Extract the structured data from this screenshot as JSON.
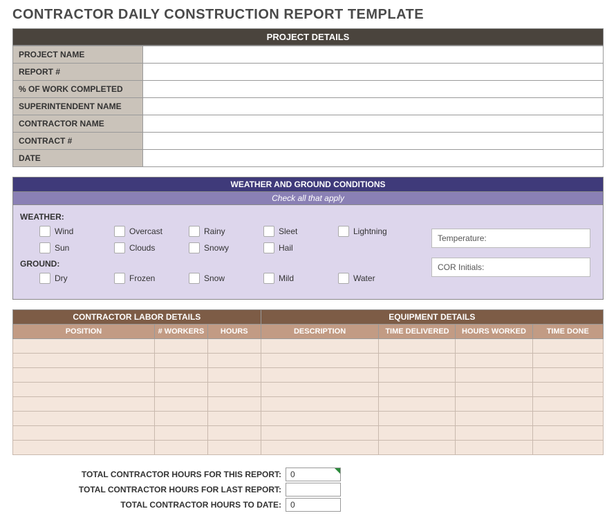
{
  "title": "CONTRACTOR DAILY CONSTRUCTION REPORT TEMPLATE",
  "project_details": {
    "header": "PROJECT DETAILS",
    "rows": [
      {
        "label": "PROJECT NAME",
        "value": ""
      },
      {
        "label": "REPORT #",
        "value": ""
      },
      {
        "label": "% OF WORK COMPLETED",
        "value": ""
      },
      {
        "label": "SUPERINTENDENT NAME",
        "value": ""
      },
      {
        "label": "CONTRACTOR NAME",
        "value": ""
      },
      {
        "label": "CONTRACT #",
        "value": ""
      },
      {
        "label": "DATE",
        "value": ""
      }
    ]
  },
  "weather": {
    "header": "WEATHER AND GROUND CONDITIONS",
    "subheader": "Check all that apply",
    "weather_label": "WEATHER:",
    "ground_label": "GROUND:",
    "weather_row1": [
      "Wind",
      "Overcast",
      "Rainy",
      "Sleet",
      "Lightning"
    ],
    "weather_row2": [
      "Sun",
      "Clouds",
      "Snowy",
      "Hail"
    ],
    "ground_row1": [
      "Dry",
      "Frozen",
      "Snow",
      "Mild",
      "Water"
    ],
    "temperature_label": "Temperature:",
    "cor_initials_label": "COR Initials:"
  },
  "labor": {
    "section1": "CONTRACTOR LABOR DETAILS",
    "section2": "EQUIPMENT DETAILS",
    "columns": [
      "POSITION",
      "# WORKERS",
      "HOURS",
      "DESCRIPTION",
      "TIME DELIVERED",
      "HOURS WORKED",
      "TIME DONE"
    ],
    "row_count": 8
  },
  "totals": {
    "rows": [
      {
        "label": "TOTAL CONTRACTOR HOURS FOR THIS REPORT:",
        "value": "0"
      },
      {
        "label": "TOTAL CONTRACTOR HOURS FOR LAST REPORT:",
        "value": ""
      },
      {
        "label": "TOTAL CONTRACTOR HOURS TO DATE:",
        "value": "0"
      }
    ]
  }
}
